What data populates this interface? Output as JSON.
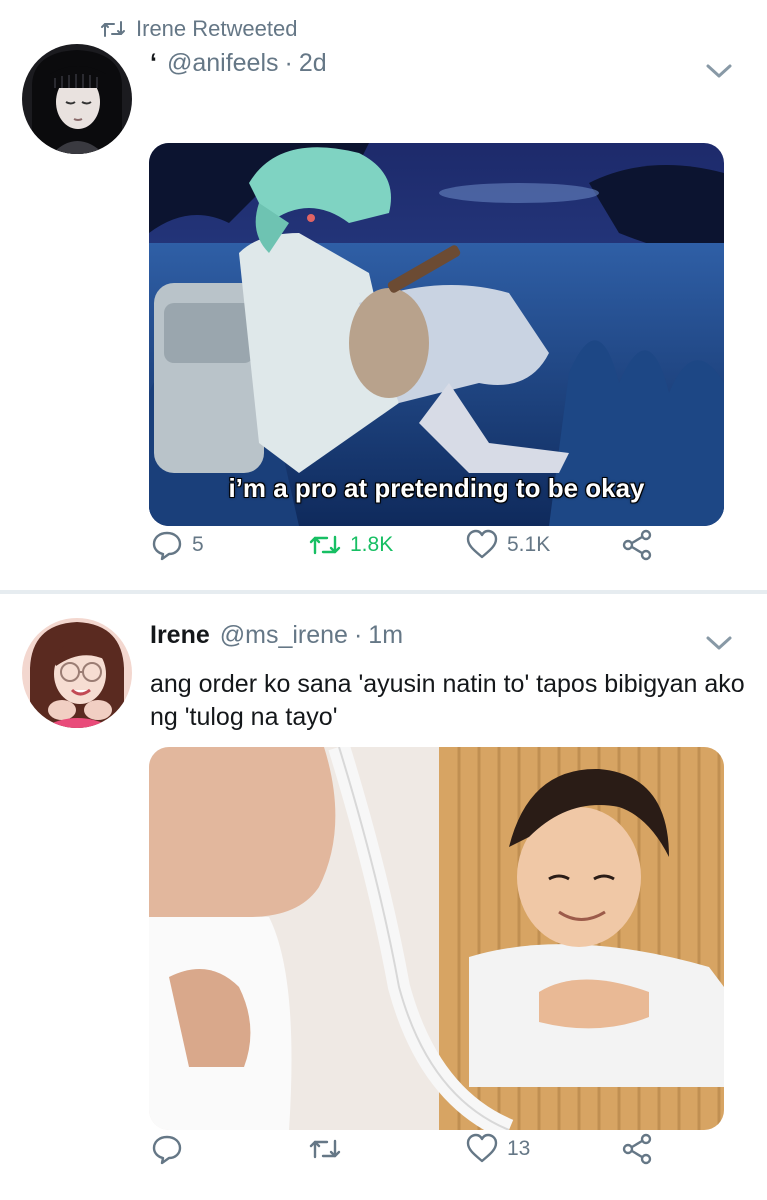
{
  "tweet1": {
    "retweet_line": "Irene Retweeted",
    "display_name": "‘",
    "handle": "@anifeels",
    "dot": "·",
    "time": "2d",
    "media_caption": "i’m a pro at pretending to be okay",
    "actions": {
      "replies": "5",
      "retweets": "1.8K",
      "likes": "5.1K"
    }
  },
  "tweet2": {
    "display_name": "Irene",
    "handle": "@ms_irene",
    "dot": "·",
    "time": "1m",
    "text": "ang order ko sana 'ayusin natin to' tapos bibigyan ako ng 'tulog na tayo'",
    "actions": {
      "replies": "",
      "retweets": "",
      "likes": "13"
    }
  },
  "colors": {
    "retweet_active": "#17bf63",
    "secondary_text": "#657786",
    "divider": "#e6ecf0"
  },
  "icons": [
    "retweet-icon",
    "chevron-down-icon",
    "reply-icon",
    "like-icon",
    "share-icon"
  ]
}
